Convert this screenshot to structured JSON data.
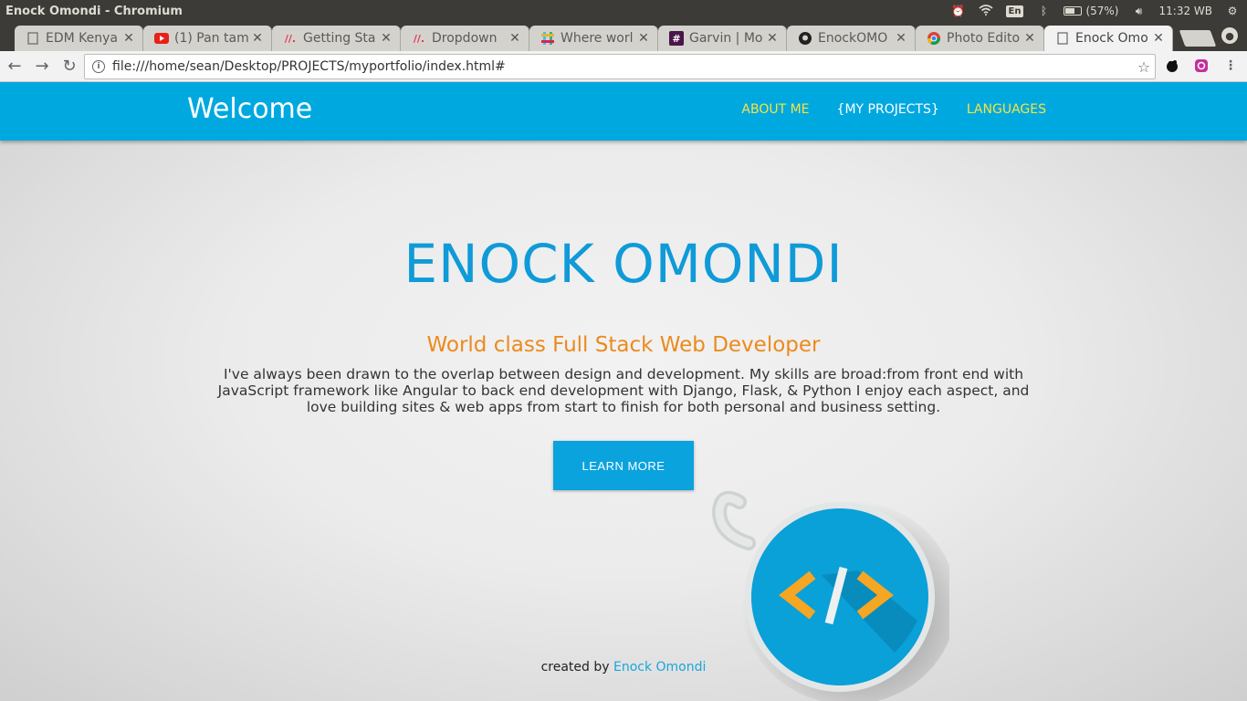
{
  "os": {
    "window_title": "Enock Omondi - Chromium",
    "lang": "En",
    "battery": "(57%)",
    "clock": "11:32 WB",
    "icons": [
      "alarm-clock-icon",
      "wifi-icon",
      "bluetooth-icon",
      "battery-icon",
      "volume-icon",
      "settings-gear-icon"
    ]
  },
  "tabs": [
    {
      "label": "EDM Kenya",
      "icon": "page-icon"
    },
    {
      "label": "(1) Pan tam",
      "icon": "youtube-icon"
    },
    {
      "label": "Getting Sta",
      "icon": "invision-icon"
    },
    {
      "label": "Dropdown",
      "icon": "invision-icon"
    },
    {
      "label": "Where worl",
      "icon": "slack-icon"
    },
    {
      "label": "Garvin | Mo",
      "icon": "hash-icon"
    },
    {
      "label": "EnockOMO",
      "icon": "github-icon"
    },
    {
      "label": "Photo Edito",
      "icon": "chrome-icon"
    },
    {
      "label": "Enock Omo",
      "icon": "page-icon"
    }
  ],
  "toolbar": {
    "url": "file:///home/sean/Desktop/PROJECTS/myportfolio/index.html#"
  },
  "site": {
    "brand": "Welcome",
    "nav": {
      "about": "ABOUT ME",
      "projects": "{MY PROJECTS}",
      "languages": "LANGUAGES"
    },
    "hero": {
      "name": "ENOCK OMONDI",
      "subtitle": "World class Full Stack Web Developer",
      "text": "I've always been drawn to the overlap between design and development. My skills are broad:from front end with JavaScript framework like Angular to back end development with Django, Flask, & Python I enjoy each aspect, and love building sites & web apps from start to finish for both personal and business setting.",
      "button": "LEARN MORE"
    },
    "footer": {
      "prefix": "created by ",
      "author": "Enock Omondi"
    },
    "colors": {
      "navbar": "#00a8e0",
      "accent_blue": "#0f9ad8",
      "accent_orange": "#ec8a1c",
      "nav_link_yellow": "#f5e442"
    }
  }
}
